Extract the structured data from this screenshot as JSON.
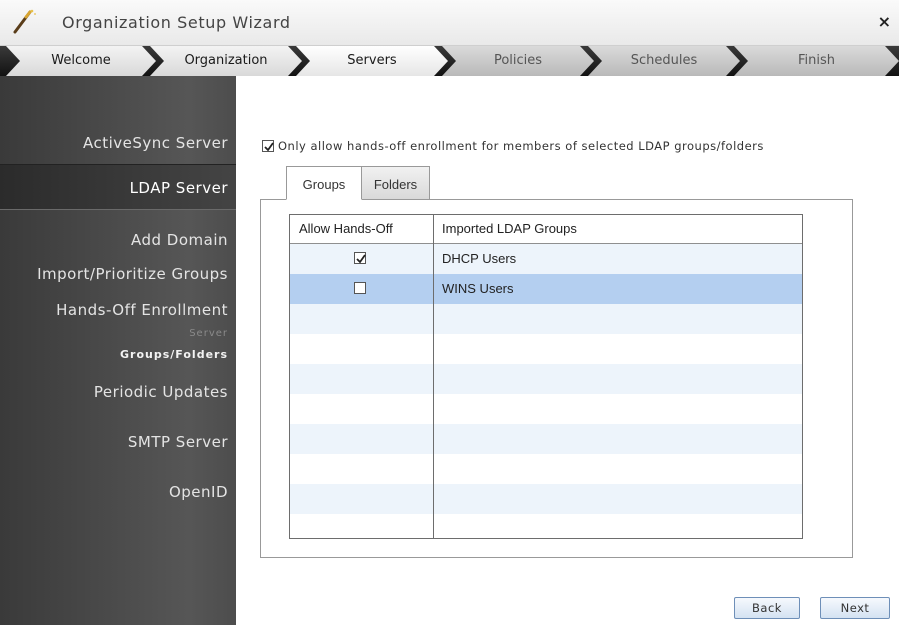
{
  "window": {
    "title": "Organization Setup Wizard",
    "close_glyph": "×",
    "icon": "wand-icon"
  },
  "steps": [
    {
      "label": "Welcome",
      "state": "done"
    },
    {
      "label": "Organization",
      "state": "done"
    },
    {
      "label": "Servers",
      "state": "current"
    },
    {
      "label": "Policies",
      "state": "todo"
    },
    {
      "label": "Schedules",
      "state": "todo"
    },
    {
      "label": "Finish",
      "state": "todo"
    }
  ],
  "sidebar": {
    "items": [
      {
        "label": "ActiveSync Server"
      },
      {
        "label": "LDAP Server",
        "active": true
      },
      {
        "label": "Add Domain"
      },
      {
        "label": "Import/Prioritize Groups"
      },
      {
        "label": "Hands-Off Enrollment"
      },
      {
        "label": "Server"
      },
      {
        "label": "Groups/Folders",
        "current_sub": true
      },
      {
        "label": "Periodic Updates"
      },
      {
        "label": "SMTP Server"
      },
      {
        "label": "OpenID"
      }
    ]
  },
  "main": {
    "restrict_checkbox": {
      "label": "Only allow hands-off enrollment for members of selected LDAP groups/folders",
      "checked": true
    },
    "tabs": [
      {
        "label": "Groups",
        "active": true
      },
      {
        "label": "Folders",
        "active": false
      }
    ],
    "table": {
      "columns": [
        "Allow Hands-Off",
        "Imported LDAP Groups"
      ],
      "rows": [
        {
          "allow": true,
          "group": "DHCP Users",
          "selected": false
        },
        {
          "allow": false,
          "group": "WINS Users",
          "selected": true
        }
      ]
    }
  },
  "buttons": {
    "back": "Back",
    "next": "Next"
  },
  "colors": {
    "sidebar_bg": "#4a4a4a",
    "selected_row": "#b4cff0",
    "alt_row": "#edf4fb",
    "button_border": "#6e8fb8"
  }
}
